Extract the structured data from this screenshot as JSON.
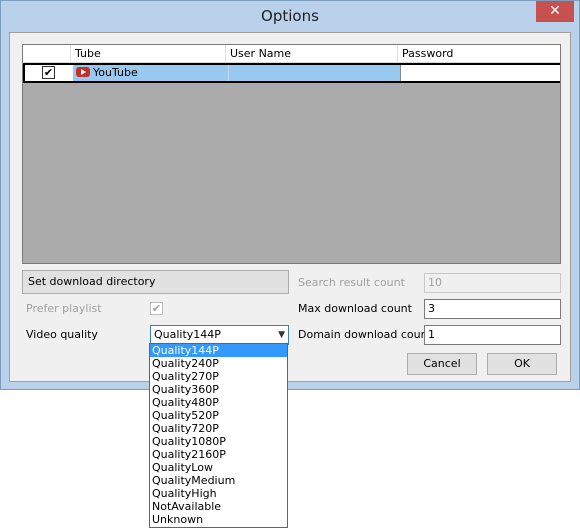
{
  "window": {
    "title": "Options",
    "close_glyph": "✕"
  },
  "grid": {
    "columns": [
      "Tube",
      "User Name",
      "Password"
    ],
    "rows": [
      {
        "checked": true,
        "tube": "YouTube",
        "user_name": "",
        "password": ""
      }
    ]
  },
  "controls": {
    "set_dir_label": "Set download directory",
    "prefer_playlist_label": "Prefer playlist",
    "prefer_playlist_checked": true,
    "video_quality_label": "Video quality",
    "video_quality_value": "Quality144P",
    "search_result_label": "Search result count",
    "search_result_value": "10",
    "max_download_label": "Max download count",
    "max_download_value": "3",
    "domain_download_label": "Domain download count",
    "domain_download_value": "1",
    "cancel_label": "Cancel",
    "ok_label": "OK"
  },
  "dropdown": {
    "selected_index": 0,
    "options": [
      "Quality144P",
      "Quality240P",
      "Quality270P",
      "Quality360P",
      "Quality480P",
      "Quality520P",
      "Quality720P",
      "Quality1080P",
      "Quality2160P",
      "QualityLow",
      "QualityMedium",
      "QualityHigh",
      "NotAvailable",
      "Unknown"
    ]
  }
}
